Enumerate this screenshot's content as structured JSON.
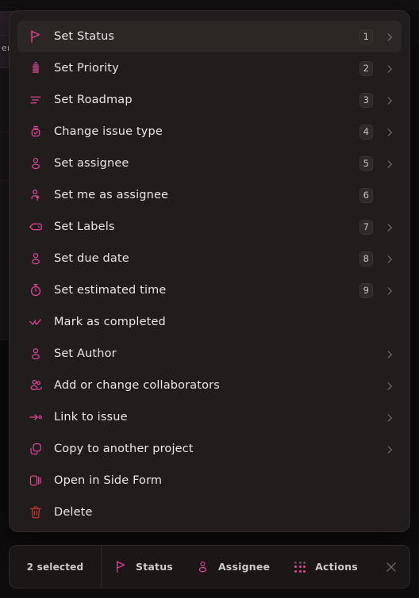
{
  "theme": {
    "accent": "#e0459a",
    "danger": "#c0392b",
    "page_bg": "#100d0d",
    "panel_bg": "#221d1d",
    "panel_border": "#332b2b",
    "highlight_bg": "#2c2625",
    "text": "#e9e6e6",
    "muted_text": "#cfcac9"
  },
  "background": {
    "partial_label": "em"
  },
  "context_menu": {
    "items": [
      {
        "label": "Set Status",
        "icon": "flag-icon",
        "shortcut": "1",
        "has_submenu": true,
        "highlighted": true,
        "danger": false
      },
      {
        "label": "Set Priority",
        "icon": "priority-bars-icon",
        "shortcut": "2",
        "has_submenu": true,
        "highlighted": false,
        "danger": false
      },
      {
        "label": "Set Roadmap",
        "icon": "roadmap-lines-icon",
        "shortcut": "3",
        "has_submenu": true,
        "highlighted": false,
        "danger": false
      },
      {
        "label": "Change issue type",
        "icon": "issue-type-icon",
        "shortcut": "4",
        "has_submenu": true,
        "highlighted": false,
        "danger": false
      },
      {
        "label": "Set assignee",
        "icon": "person-icon",
        "shortcut": "5",
        "has_submenu": true,
        "highlighted": false,
        "danger": false
      },
      {
        "label": "Set me as assignee",
        "icon": "person-arrow-icon",
        "shortcut": "6",
        "has_submenu": false,
        "highlighted": false,
        "danger": false
      },
      {
        "label": "Set Labels",
        "icon": "tag-icon",
        "shortcut": "7",
        "has_submenu": true,
        "highlighted": false,
        "danger": false
      },
      {
        "label": "Set due date",
        "icon": "person-icon",
        "shortcut": "8",
        "has_submenu": true,
        "highlighted": false,
        "danger": false
      },
      {
        "label": "Set estimated time",
        "icon": "stopwatch-icon",
        "shortcut": "9",
        "has_submenu": true,
        "highlighted": false,
        "danger": false
      },
      {
        "label": "Mark as completed",
        "icon": "double-check-icon",
        "shortcut": "",
        "has_submenu": false,
        "highlighted": false,
        "danger": false
      },
      {
        "label": "Set Author",
        "icon": "person-icon",
        "shortcut": "",
        "has_submenu": true,
        "highlighted": false,
        "danger": false
      },
      {
        "label": "Add or change collaborators",
        "icon": "people-icon",
        "shortcut": "",
        "has_submenu": true,
        "highlighted": false,
        "danger": false
      },
      {
        "label": "Link to issue",
        "icon": "link-arrow-icon",
        "shortcut": "",
        "has_submenu": true,
        "highlighted": false,
        "danger": false
      },
      {
        "label": "Copy to another project",
        "icon": "copy-icon",
        "shortcut": "",
        "has_submenu": true,
        "highlighted": false,
        "danger": false
      },
      {
        "label": "Open in Side Form",
        "icon": "side-form-icon",
        "shortcut": "",
        "has_submenu": false,
        "highlighted": false,
        "danger": false
      },
      {
        "label": "Delete",
        "icon": "trash-icon",
        "shortcut": "",
        "has_submenu": false,
        "highlighted": false,
        "danger": true
      }
    ]
  },
  "selection_bar": {
    "count_label": "2 selected",
    "actions": [
      {
        "label": "Status",
        "icon": "flag-icon"
      },
      {
        "label": "Assignee",
        "icon": "person-icon"
      },
      {
        "label": "Actions",
        "icon": "dot-grid-icon"
      }
    ],
    "close_icon": "close-icon"
  }
}
